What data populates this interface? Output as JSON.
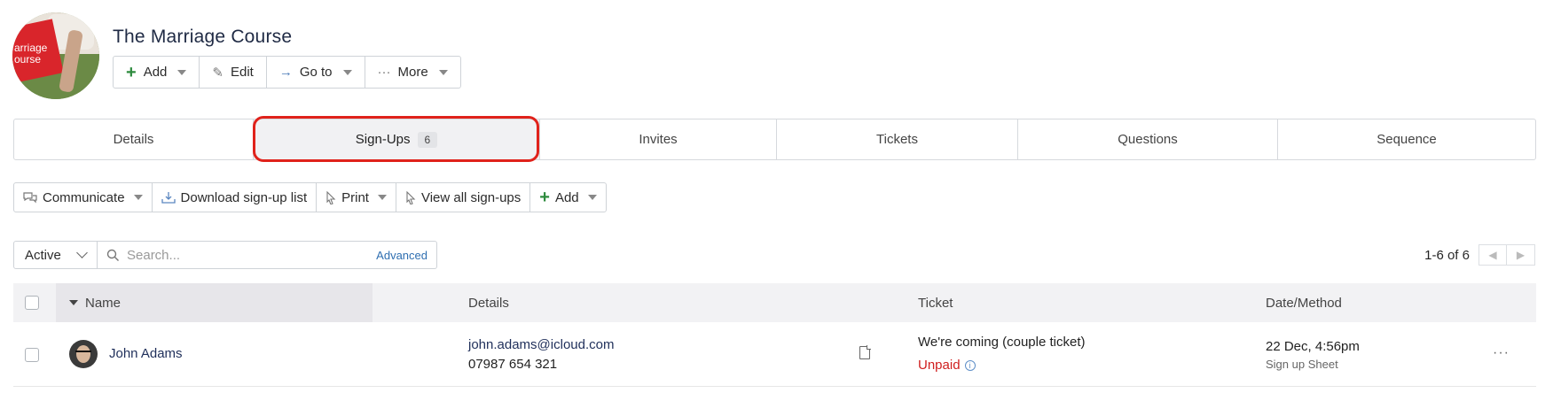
{
  "event": {
    "title": "The Marriage Course",
    "image_text": "arriage\nourse"
  },
  "actions": {
    "add": "Add",
    "edit": "Edit",
    "goto": "Go to",
    "more": "More"
  },
  "tabs": [
    {
      "label": "Details"
    },
    {
      "label": "Sign-Ups",
      "count": "6",
      "active": true
    },
    {
      "label": "Invites"
    },
    {
      "label": "Tickets"
    },
    {
      "label": "Questions"
    },
    {
      "label": "Sequence"
    }
  ],
  "toolbar": {
    "communicate": "Communicate",
    "download": "Download sign-up list",
    "print": "Print",
    "view_all": "View all sign-ups",
    "add": "Add"
  },
  "filter": {
    "status": "Active",
    "search_placeholder": "Search...",
    "advanced": "Advanced"
  },
  "pager": {
    "range": "1-6",
    "of_label": "of",
    "total": "6"
  },
  "table": {
    "columns": [
      "Name",
      "Details",
      "Ticket",
      "Date/Method"
    ],
    "rows": [
      {
        "name": "John Adams",
        "email": "john.adams@icloud.com",
        "phone": "07987 654 321",
        "ticket": "We're coming (couple ticket)",
        "payment_status": "Unpaid",
        "date": "22 Dec, 4:56pm",
        "method": "Sign up Sheet"
      }
    ]
  },
  "colors": {
    "accent_green": "#2e8b3e",
    "highlight_red": "#e0221b",
    "unpaid_red": "#d01f1f",
    "link_blue": "#2f6fb1"
  }
}
